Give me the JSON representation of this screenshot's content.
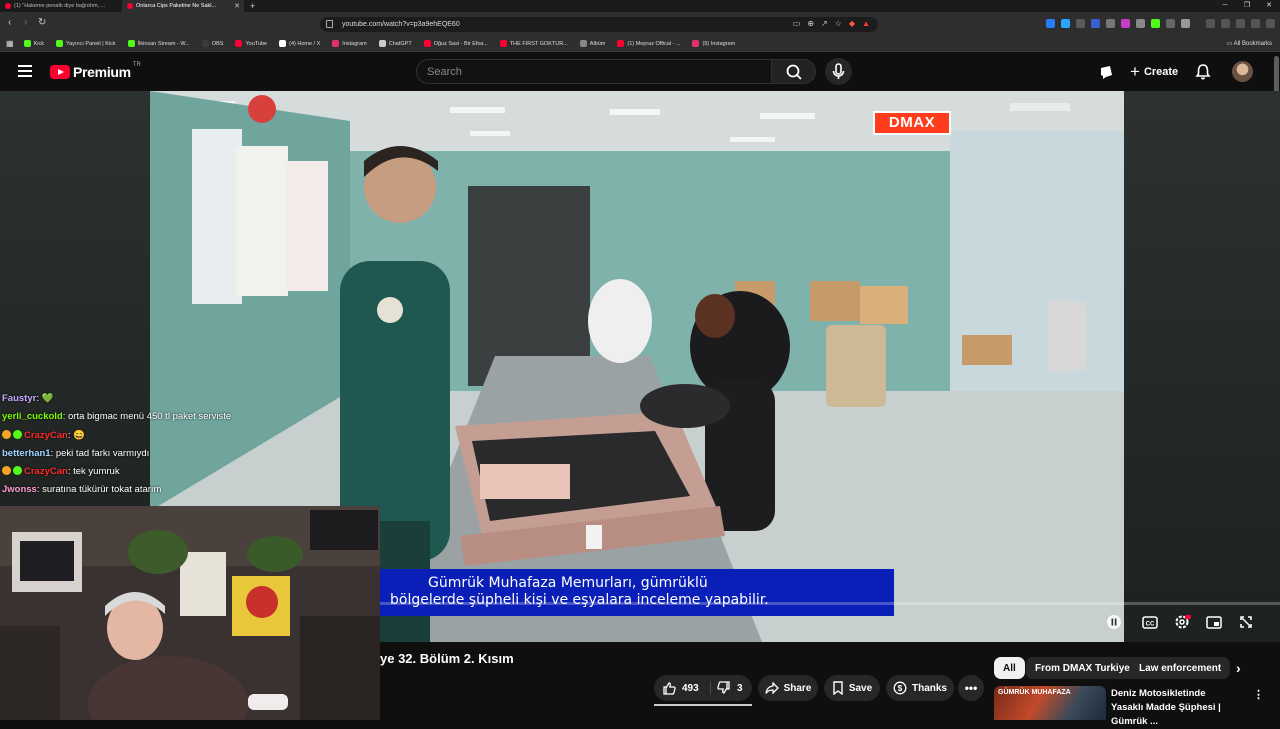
{
  "browser": {
    "tabs": [
      {
        "title": "(1) \"Hakeme penaltı diye bağırdım, ...",
        "active": false
      },
      {
        "title": "Onlarca Cips Paketine Ne Sakl...",
        "active": true
      }
    ],
    "new_tab": "+",
    "url": "youtube.com/watch?v=p3a9ehEQE60",
    "bookmarks": [
      {
        "label": "Kick",
        "color": "#53fc18"
      },
      {
        "label": "Yayıncı Paneli | Kick",
        "color": "#53fc18"
      },
      {
        "label": "İlkinsan Stream - W...",
        "color": "#53fc18"
      },
      {
        "label": "OBS",
        "color": "#3a3a3a"
      },
      {
        "label": "YouTube",
        "color": "#ff0033"
      },
      {
        "label": "(4) Home / X",
        "color": "#ffffff"
      },
      {
        "label": "Instagram",
        "color": "#e1306c"
      },
      {
        "label": "ChatGPT",
        "color": "#cccccc"
      },
      {
        "label": "Oğuz Sasi - Bir Efsa...",
        "color": "#ff0033"
      },
      {
        "label": "THE FIRST GOKTUR...",
        "color": "#ff0033"
      },
      {
        "label": "Albüm",
        "color": "#888888"
      },
      {
        "label": "(1) Mepraz Offical - ...",
        "color": "#ff0033"
      },
      {
        "label": "(9) Instagram",
        "color": "#e1306c"
      }
    ],
    "all_bookmarks": "All Bookmarks"
  },
  "masthead": {
    "logo_word": "Premium",
    "country": "TR",
    "search_placeholder": "Search",
    "create_label": "Create"
  },
  "player": {
    "channel_bug": "DMAX",
    "subtitle_line1": "Gümrük Muhafaza Memurları, gümrüklü",
    "subtitle_line2": "bölgelerde şüpheli kişi ve eşyalara inceleme yapabilir."
  },
  "chat": [
    {
      "user": "Faustyr",
      "message": "💚",
      "color": "#c6a8ff",
      "badges": []
    },
    {
      "user": "yerli_cuckold",
      "message": "orta bigmac menü 450 tl paket serviste",
      "color": "#7cfc00",
      "badges": []
    },
    {
      "user": "CrazyCan",
      "message": "😄",
      "color": "#ff2a2a",
      "badges": [
        "#f5a623",
        "#53fc18"
      ]
    },
    {
      "user": "betterhan1",
      "message": "peki tad farkı varmıydı",
      "color": "#9fd6ff",
      "badges": []
    },
    {
      "user": "CrazyCan",
      "message": "tek yumruk",
      "color": "#ff2a2a",
      "badges": [
        "#f5a623",
        "#53fc18"
      ]
    },
    {
      "user": "Jwonss",
      "message": "suratına tükürür tokat atarım",
      "color": "#ff9ad5",
      "badges": []
    }
  ],
  "video": {
    "title": "ye 32. Bölüm 2. Kısım",
    "like_count": "493",
    "dislike_count": "3",
    "share_label": "Share",
    "save_label": "Save",
    "thanks_label": "Thanks"
  },
  "chips": [
    "All",
    "From DMAX Turkiye",
    "Law enforcement"
  ],
  "recommendation": {
    "thumb_label": "GÜMRÜK MUHAFAZA",
    "title": "Deniz Motosikletinde Yasaklı Madde Şüphesi | Gümrük ..."
  }
}
